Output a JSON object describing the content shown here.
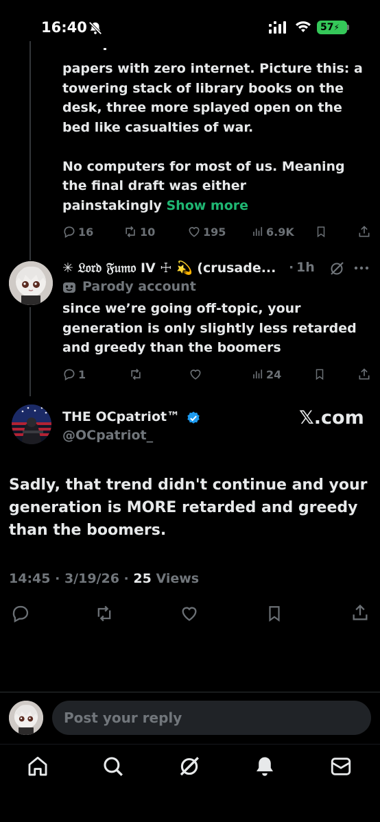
{
  "status_bar": {
    "time": "16:40",
    "battery": "57"
  },
  "prev_post": {
    "text_lines": [
      "papers with zero internet. Picture this: a",
      "towering stack of library books on the",
      "desk, three more splayed open on the",
      "bed like casualties of war.",
      "",
      "No computers for most of us. Meaning",
      "the final draft was either",
      "painstakingly"
    ],
    "show_more": "Show more",
    "replies": "16",
    "reposts": "10",
    "likes": "195",
    "views": "6.9K"
  },
  "reply_post": {
    "name": "✳ 𝔏𝔬𝔯𝔡 𝔉𝔲𝔪𝔬 IV ☩ 💫 (crusade...",
    "time_sep": "·",
    "time": "1h",
    "parody_label": "Parody account",
    "text_lines": [
      "since we’re going off-topic, your",
      "generation is only slightly less retarded",
      "and greedy than the boomers"
    ],
    "replies": "1",
    "views": "24"
  },
  "main_post": {
    "name": "THE OCpatriot™",
    "handle": "@OCpatriot_",
    "watermark": "𝕏.com",
    "text_lines": [
      "Sadly, that trend didn't continue and your",
      "generation is MORE retarded and greedy",
      "than the boomers."
    ],
    "time": "14:45",
    "date": "3/19/26",
    "views_count": "25",
    "views_label": "Views"
  },
  "composer": {
    "placeholder": "Post your reply"
  },
  "icons": {
    "accent": "#1d9bf0",
    "show_more_color": "#1fb773",
    "muted_color": "#71767b",
    "verified": "blue-check",
    "nav": [
      "home-icon",
      "search-icon",
      "grok-icon",
      "notifications-icon",
      "messages-icon"
    ]
  }
}
